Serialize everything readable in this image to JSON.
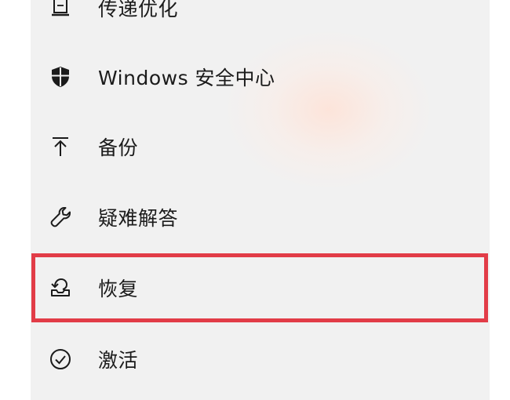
{
  "nav": {
    "items": [
      {
        "id": "delivery-optimization",
        "label": "传递优化",
        "icon": "delivery-optimization-icon"
      },
      {
        "id": "windows-security",
        "label": "Windows 安全中心",
        "icon": "shield-icon"
      },
      {
        "id": "backup",
        "label": "备份",
        "icon": "upload-arrow-icon"
      },
      {
        "id": "troubleshoot",
        "label": "疑难解答",
        "icon": "wrench-icon"
      },
      {
        "id": "recovery",
        "label": "恢复",
        "icon": "recovery-icon"
      },
      {
        "id": "activation",
        "label": "激活",
        "icon": "check-circle-icon"
      }
    ]
  },
  "colors": {
    "panel_bg": "#f1f1f1",
    "text": "#1b1b1b",
    "highlight": "#e23c47"
  }
}
